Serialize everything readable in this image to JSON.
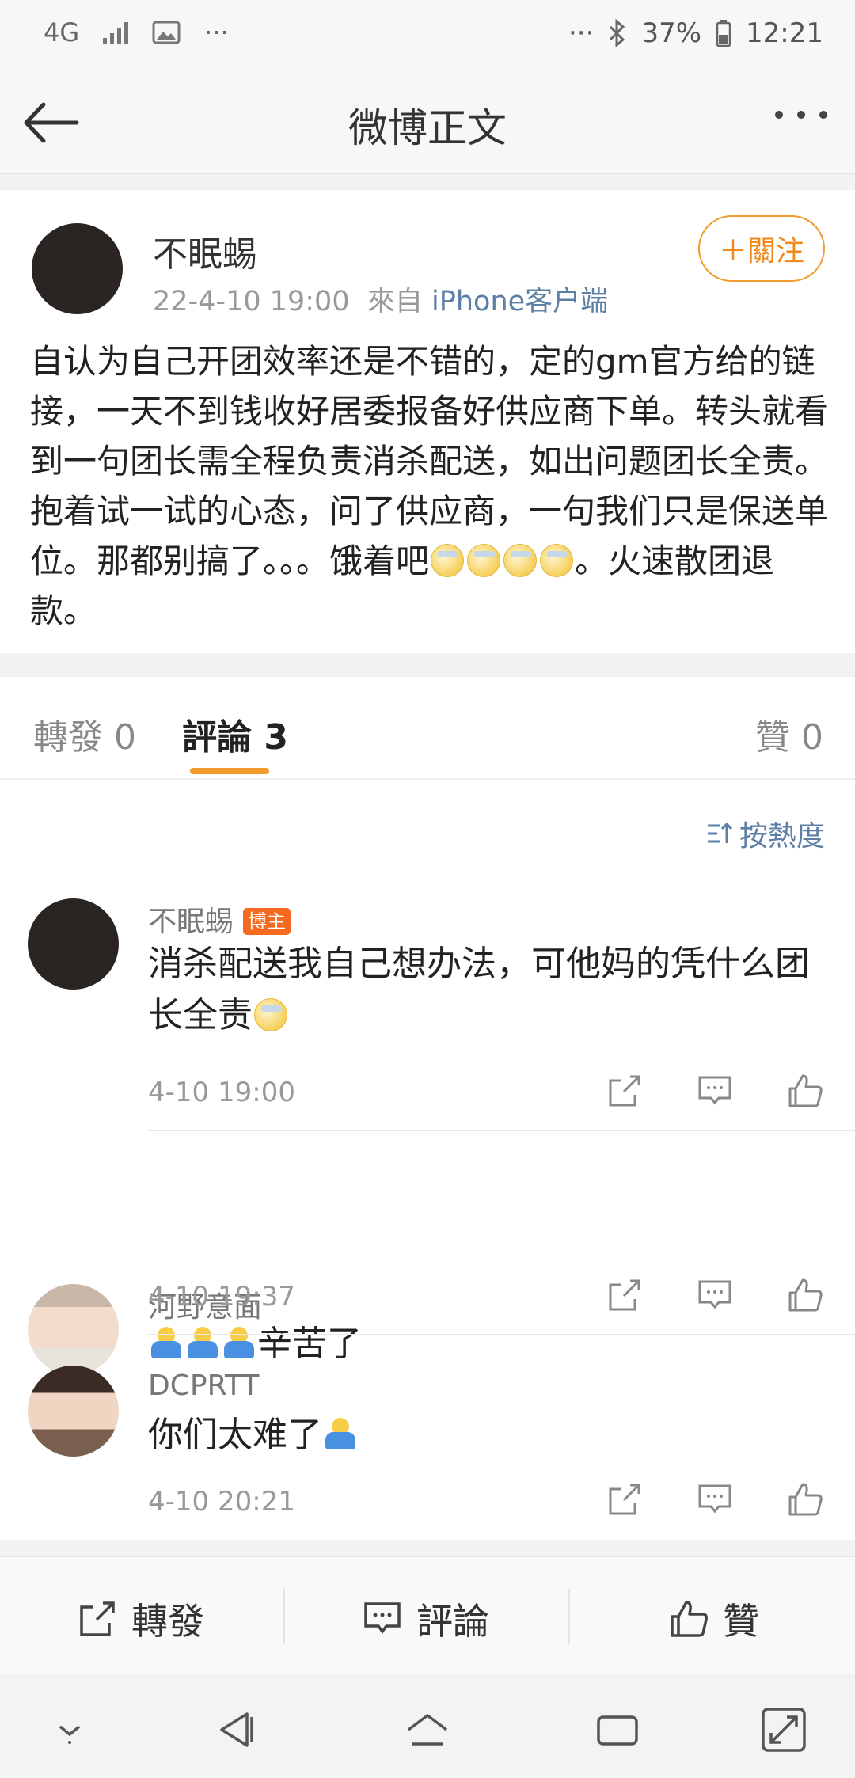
{
  "status_bar": {
    "network": "4G",
    "more": "···",
    "battery": "37%",
    "time": "12:21"
  },
  "nav": {
    "title": "微博正文"
  },
  "post": {
    "author": "不眠蜴",
    "date": "22-4-10 19:00",
    "from_label": "來自",
    "source": "iPhone客户端",
    "follow_label": "＋關注",
    "text_main": "自认为自己开团效率还是不错的，定的gm官方给的链接，一天不到钱收好居委报备好供应商下单。转头就看到一句团长需全程负责消杀配送，如出问题团长全责。抱着试一试的心态，问了供应商，一句我们只是保送单位。那都别搞了。。。饿着吧",
    "text_end": "。火速散团退款。"
  },
  "tabs": {
    "repost": "轉發 0",
    "comments": "評論 3",
    "likes": "贊 0"
  },
  "sort_label": "按熱度",
  "comments": [
    {
      "name": "不眠蜴",
      "badge": "博主",
      "text": "消杀配送我自己想办法，可他妈的凭什么团长全责",
      "time": "4-10 19:00"
    },
    {
      "name": "河野意面",
      "text": "辛苦了",
      "time": "4-10 19:37"
    },
    {
      "name": "DCPRTT",
      "text": "你们太难了",
      "time": "4-10 20:21"
    }
  ],
  "toolbar": {
    "repost": "轉發",
    "comment": "評論",
    "like": "贊"
  },
  "colors": {
    "accent_orange": "#f39b2e",
    "link_blue": "#5d7fa6",
    "badge_orange": "#f56a1e"
  }
}
